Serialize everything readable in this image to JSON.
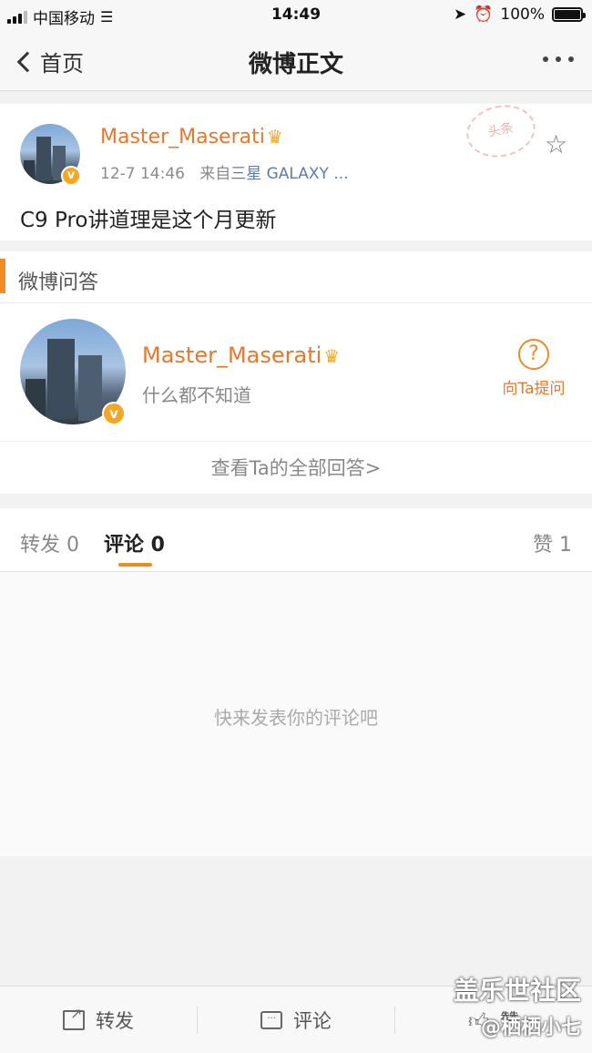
{
  "status_bar": {
    "carrier": "中国移动",
    "time": "14:49",
    "battery": "100%"
  },
  "nav": {
    "back_label": "首页",
    "title": "微博正文"
  },
  "post": {
    "username": "Master_Maserati",
    "time": "12-7 14:46",
    "source_prefix": "来自",
    "source": "三星 GALAXY ...",
    "text": "C9 Pro讲道理是这个月更新",
    "stamp": "头条"
  },
  "qa": {
    "section_title": "微博问答",
    "username": "Master_Maserati",
    "subtitle": "什么都不知道",
    "ask_label": "向Ta提问",
    "view_all": "查看Ta的全部回答>"
  },
  "tabs": {
    "repost": "转发 0",
    "comment": "评论 0",
    "like": "赞 1"
  },
  "comments": {
    "empty_text": "快来发表你的评论吧"
  },
  "toolbar": {
    "repost": "转发",
    "comment": "评论",
    "like": "赞"
  },
  "watermark": {
    "line1": "盖乐世社区",
    "line2": "@栖栖小七"
  },
  "colors": {
    "accent": "#f08a24",
    "username": "#e8772e",
    "source_link": "#5b7ea8"
  }
}
